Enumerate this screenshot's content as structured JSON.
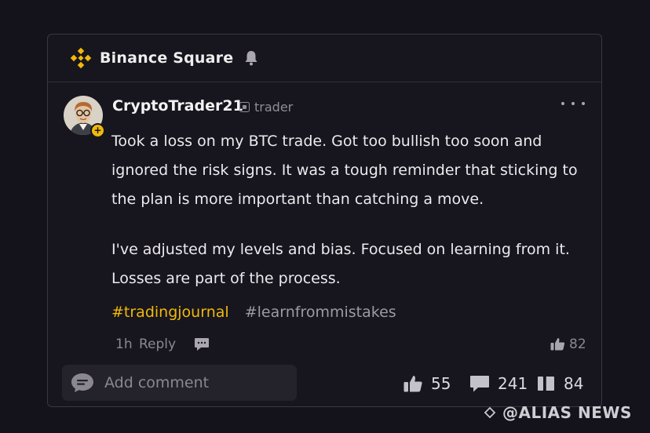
{
  "header": {
    "title": "Binance Square"
  },
  "post": {
    "username": "CryptoTrader21",
    "role": "trader",
    "paragraphs": [
      "Took a loss on my BTC trade. Got too bullish too soon and ignored the risk signs. It was a tough reminder that sticking to the plan is more important than catching a move.",
      "I've adjusted my levels and bias. Focused on learning from it. Losses are part of the process."
    ],
    "tags": [
      "#tradingjournal",
      "#learnfrommistakes"
    ],
    "time": "1h",
    "reply_label": "Reply",
    "like_count_small": "82"
  },
  "footer": {
    "comment_placeholder": "Add comment",
    "likes": "55",
    "comments": "241",
    "shares": "84"
  },
  "watermark": {
    "text": "@ALIAS NEWS"
  },
  "colors": {
    "accent": "#f0b90b",
    "background": "#14121a",
    "card": "#17151d"
  }
}
